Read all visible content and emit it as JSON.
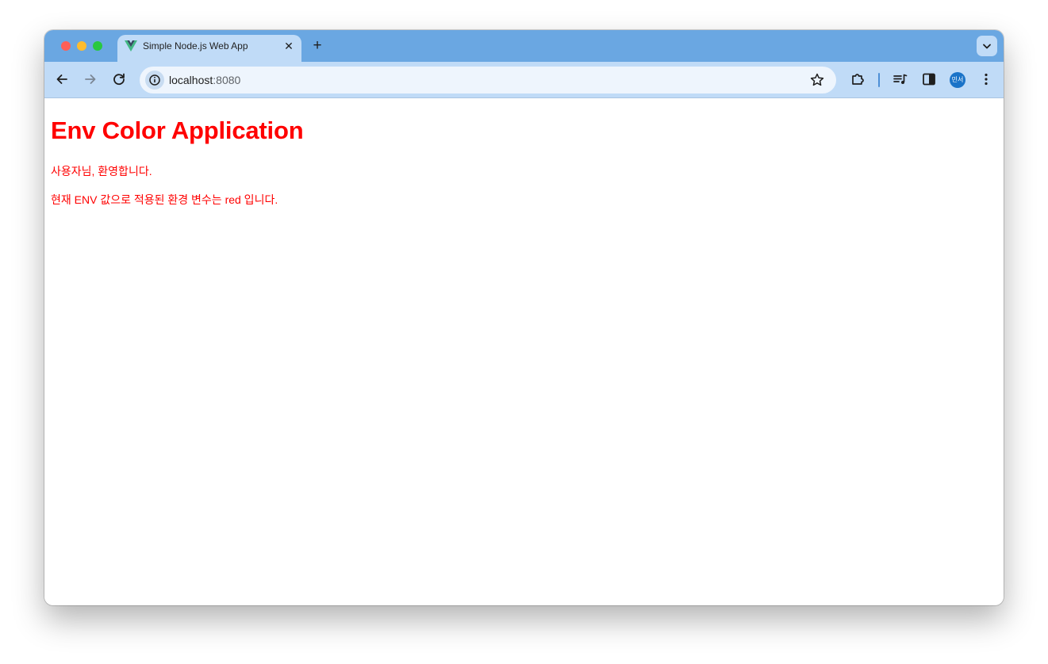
{
  "browser": {
    "tab": {
      "title": "Simple Node.js Web App",
      "close_glyph": "✕",
      "favicon": "vue-logo-icon"
    },
    "new_tab_glyph": "+",
    "address_bar": {
      "host": "localhost",
      "port": ":8080"
    },
    "profile_avatar_text": "민서",
    "colors": {
      "tab_strip": "#6aa7e2",
      "toolbar": "#c0dbf7",
      "omnibox": "#eef5fd",
      "avatar": "#1a73c8"
    }
  },
  "page": {
    "heading": "Env Color Application",
    "greeting": "사용자님, 환영합니다.",
    "env_message": "현재 ENV 값으로 적용된 환경 변수는 red 입니다.",
    "text_color": "#ff0000"
  }
}
